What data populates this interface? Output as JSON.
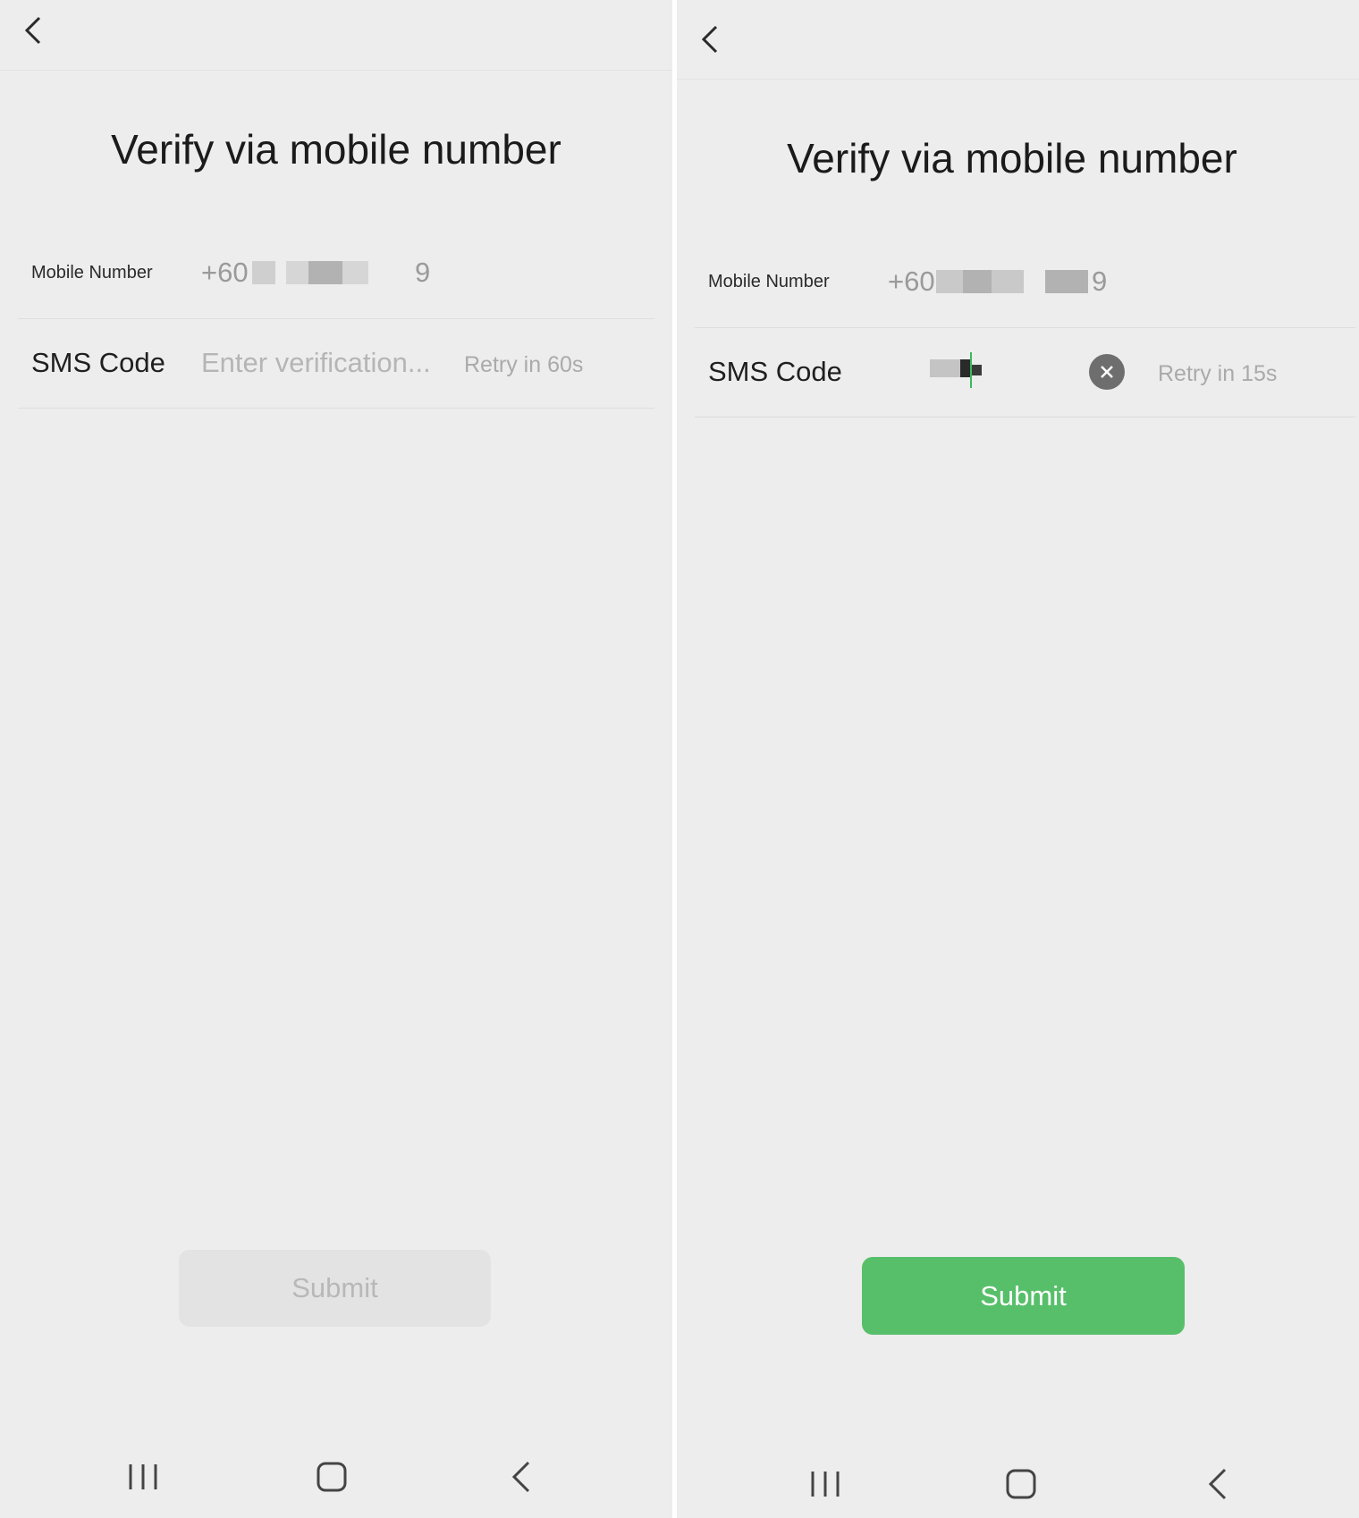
{
  "screens": [
    {
      "title": "Verify via mobile number",
      "mobile_label": "Mobile Number",
      "mobile_value_prefix": "+60",
      "mobile_value_suffix": "9",
      "sms_label": "SMS Code",
      "sms_placeholder": "Enter verification...",
      "sms_value": "",
      "retry_text": "Retry in 60s",
      "submit_label": "Submit",
      "submit_enabled": false
    },
    {
      "title": "Verify via mobile number",
      "mobile_label": "Mobile Number",
      "mobile_value_prefix": "+60",
      "mobile_value_suffix": "9",
      "sms_label": "SMS Code",
      "retry_text": "Retry in 15s",
      "submit_label": "Submit",
      "submit_enabled": true
    }
  ],
  "icons": {
    "back": "chevron-left-icon",
    "clear": "clear-circle-icon",
    "nav_recents": "recents-icon",
    "nav_home": "home-icon",
    "nav_back": "nav-back-icon"
  },
  "colors": {
    "background": "#ededed",
    "accent_green": "#57bf6a",
    "disabled_button": "#e3e3e3",
    "muted_text": "#aaaaaa"
  }
}
